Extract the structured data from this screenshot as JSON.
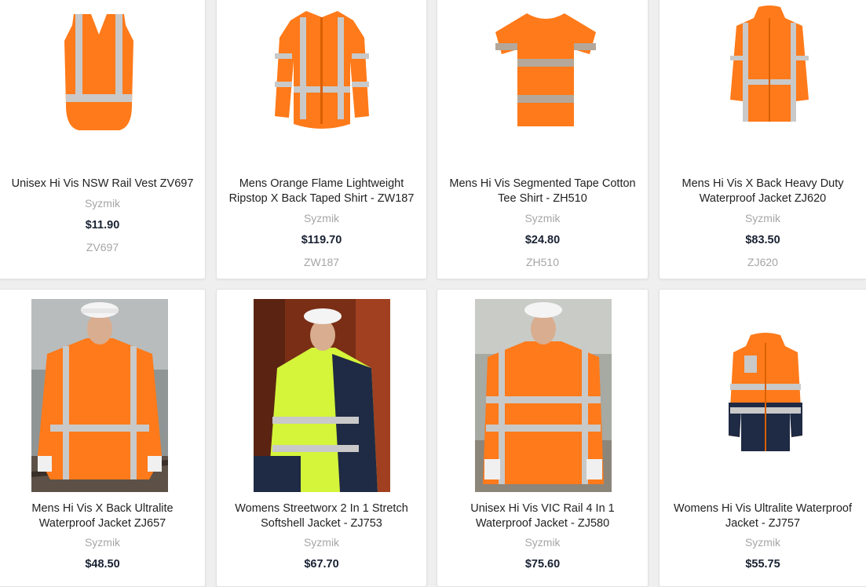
{
  "products": [
    {
      "name": "Unisex Hi Vis NSW Rail Vest ZV697",
      "brand": "Syzmik",
      "price": "$11.90",
      "sku": "ZV697",
      "image_icon": "hi-vis-vest-icon"
    },
    {
      "name": "Mens Orange Flame Lightweight Ripstop X Back Taped Shirt - ZW187",
      "brand": "Syzmik",
      "price": "$119.70",
      "sku": "ZW187",
      "image_icon": "long-sleeve-shirt-icon"
    },
    {
      "name": "Mens Hi Vis Segmented Tape Cotton Tee Shirt - ZH510",
      "brand": "Syzmik",
      "price": "$24.80",
      "sku": "ZH510",
      "image_icon": "tee-shirt-icon"
    },
    {
      "name": "Mens Hi Vis X Back Heavy Duty Waterproof Jacket ZJ620",
      "brand": "Syzmik",
      "price": "$83.50",
      "sku": "ZJ620",
      "image_icon": "hooded-jacket-icon"
    },
    {
      "name": "Mens Hi Vis X Back Ultralite Waterproof Jacket ZJ657",
      "brand": "Syzmik",
      "price": "$48.50",
      "image_icon": "worker-photo-icon"
    },
    {
      "name": "Womens Streetworx 2 In 1 Stretch Softshell Jacket - ZJ753",
      "brand": "Syzmik",
      "price": "$67.70",
      "image_icon": "worker-photo-icon"
    },
    {
      "name": "Unisex Hi Vis VIC Rail 4 In 1 Waterproof Jacket - ZJ580",
      "brand": "Syzmik",
      "price": "$75.60",
      "image_icon": "worker-photo-icon"
    },
    {
      "name": "Womens Hi Vis Ultralite Waterproof Jacket - ZJ757",
      "brand": "Syzmik",
      "price": "$55.75",
      "image_icon": "two-tone-jacket-icon"
    }
  ],
  "colors": {
    "hi_vis_orange": "#ff7a1a",
    "hi_vis_yellow": "#d4f53a",
    "navy": "#1f2a44",
    "tape_silver": "#c9c9c9",
    "price_text": "#1a2233",
    "muted_text": "#a6a6a6"
  }
}
